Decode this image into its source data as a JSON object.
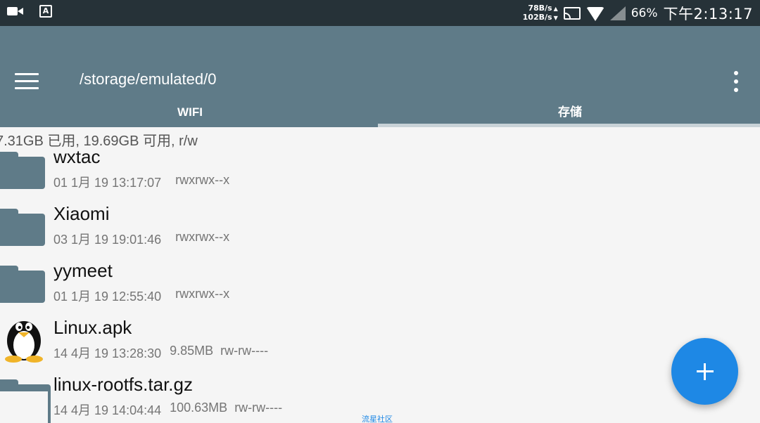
{
  "status_bar": {
    "net_up": "78B/s",
    "net_down": "102B/s",
    "battery": "66%",
    "time": "下午2:13:17",
    "icons": [
      "video-icon",
      "a-icon",
      "cast-icon",
      "wifi-icon",
      "signal-icon"
    ]
  },
  "app_bar": {
    "path": "/storage/emulated/0",
    "icons": [
      "menu-icon",
      "more-icon"
    ]
  },
  "tabs": [
    {
      "label": "WIFI",
      "selected": false
    },
    {
      "label": "存储",
      "selected": true
    }
  ],
  "storage_info": "7.31GB 已用, 19.69GB 可用, r/w",
  "files": [
    {
      "name": "wxtac",
      "date": "01 1月 19 13:17:07",
      "size": "",
      "perms": "rwxrwx--x",
      "icon": "folder-icon"
    },
    {
      "name": "Xiaomi",
      "date": "03 1月 19 19:01:46",
      "size": "",
      "perms": "rwxrwx--x",
      "icon": "folder-icon"
    },
    {
      "name": "yymeet",
      "date": "01 1月 19 12:55:40",
      "size": "",
      "perms": "rwxrwx--x",
      "icon": "folder-icon"
    },
    {
      "name": "Linux.apk",
      "date": "14 4月 19 13:28:30",
      "size": "9.85MB",
      "perms": "rw-rw----",
      "icon": "tux-icon"
    },
    {
      "name": "linux-rootfs.tar.gz",
      "date": "14 4月 19 14:04:44",
      "size": "100.63MB",
      "perms": "rw-rw----",
      "icon": "archive-icon"
    }
  ],
  "fab": {
    "icon": "plus-icon",
    "color": "#1e88e5"
  },
  "watermark": "流星社区",
  "colors": {
    "status_bar": "#263238",
    "app_bar": "#5f7b88",
    "accent": "#1e88e5",
    "background": "#f5f5f5"
  }
}
